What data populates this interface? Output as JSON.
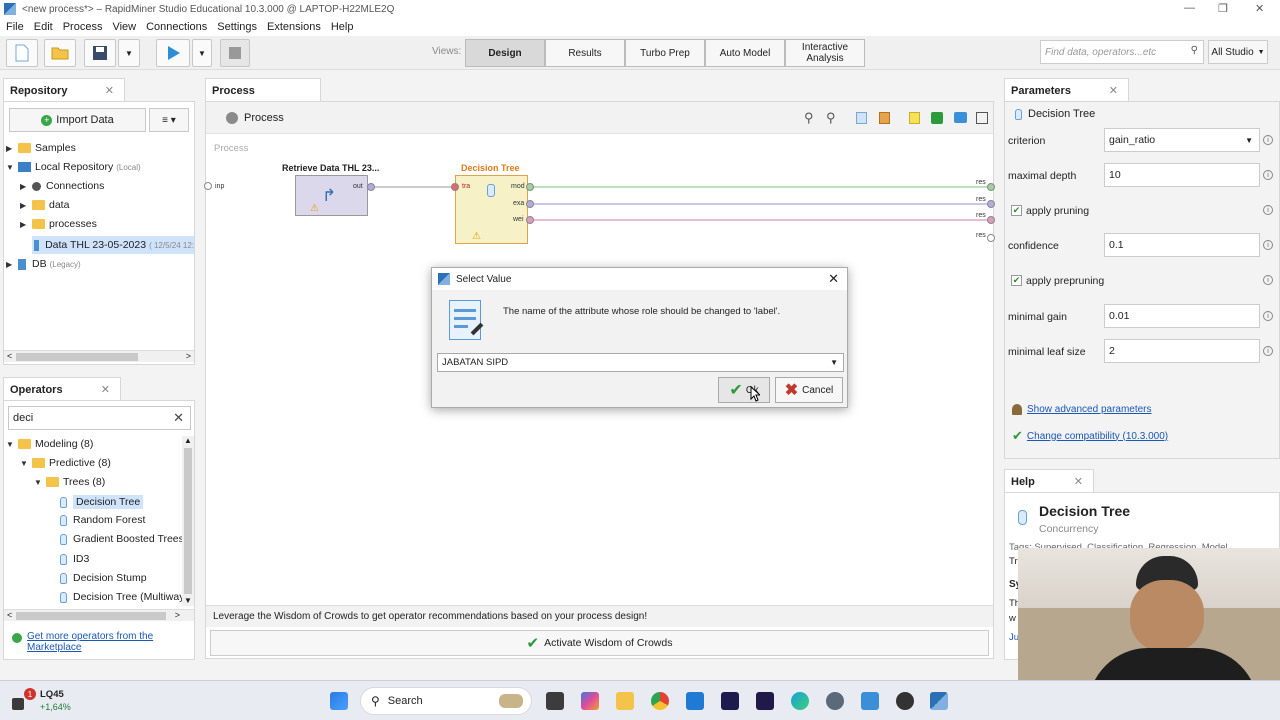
{
  "window": {
    "title": "<new process*> – RapidMiner Studio Educational 10.3.000 @ LAPTOP-H22MLE2Q",
    "controls": [
      "—",
      "❐",
      "✕"
    ]
  },
  "menu": [
    "File",
    "Edit",
    "Process",
    "View",
    "Connections",
    "Settings",
    "Extensions",
    "Help"
  ],
  "toolbar": {
    "views_label": "Views:",
    "views": [
      "Design",
      "Results",
      "Turbo Prep",
      "Auto Model",
      "Interactive Analysis"
    ],
    "active_view": "Design",
    "search_placeholder": "Find data, operators...etc",
    "perspective": "All Studio"
  },
  "repository": {
    "tab": "Repository",
    "import_button": "Import Data",
    "items": [
      {
        "label": "Samples",
        "sub": ""
      },
      {
        "label": "Local Repository",
        "sub": "(Local)"
      },
      {
        "label": "Connections",
        "sub": ""
      },
      {
        "label": "data",
        "sub": ""
      },
      {
        "label": "processes",
        "sub": ""
      },
      {
        "label": "Data THL 23-05-2023",
        "sub": "( 12/5/24 12:"
      },
      {
        "label": "DB",
        "sub": "(Legacy)"
      }
    ]
  },
  "operators": {
    "tab": "Operators",
    "search_value": "deci",
    "items": [
      {
        "label": "Modeling (8)"
      },
      {
        "label": "Predictive (8)"
      },
      {
        "label": "Trees (8)"
      },
      {
        "label": "Decision Tree"
      },
      {
        "label": "Random Forest"
      },
      {
        "label": "Gradient Boosted Trees"
      },
      {
        "label": "ID3"
      },
      {
        "label": "Decision Stump"
      },
      {
        "label": "Decision Tree (Multiway)"
      }
    ],
    "marketplace_link": "Get more operators from the Marketplace"
  },
  "process": {
    "tab": "Process",
    "breadcrumb": "Process",
    "canvas_label": "Process",
    "operator1": {
      "name": "Retrieve Data THL 23...",
      "port_out": "out"
    },
    "operator2": {
      "name": "Decision Tree",
      "ports_in": [
        "tra"
      ],
      "ports_out": [
        "mod",
        "exa",
        "wei"
      ]
    },
    "inp_label": "inp",
    "res_labels": [
      "res",
      "res",
      "res",
      "res"
    ],
    "wisdom_text": "Leverage the Wisdom of Crowds to get operator recommendations based on your process design!",
    "wisdom_button": "Activate Wisdom of Crowds"
  },
  "dialog": {
    "title": "Select Value",
    "message": "The name of the attribute whose role should be changed to 'label'.",
    "selected": "JABATAN SIPD",
    "ok": "Ok",
    "cancel": "Cancel"
  },
  "parameters": {
    "tab": "Parameters",
    "operator": "Decision Tree",
    "rows": [
      {
        "label": "criterion",
        "value": "gain_ratio"
      },
      {
        "label": "maximal depth",
        "value": "10"
      },
      {
        "label": "apply pruning",
        "value": ""
      },
      {
        "label": "confidence",
        "value": "0.1"
      },
      {
        "label": "apply prepruning",
        "value": ""
      },
      {
        "label": "minimal gain",
        "value": "0.01"
      },
      {
        "label": "minimal leaf size",
        "value": "2"
      }
    ],
    "advanced_link": "Show advanced parameters",
    "compat_link": "Change compatibility (10.3.000)"
  },
  "help": {
    "tab": "Help",
    "title": "Decision Tree",
    "subtitle": "Concurrency",
    "tags": "Tags: Supervised, Classification, Regression, Model,",
    "partial1": "Tr",
    "partial2": "Sy",
    "partial3": "Th",
    "partial4": "w",
    "partial5": "Ju"
  },
  "taskbar": {
    "ticker": "LQ45",
    "ticker_change": "+1,64%",
    "search": "Search",
    "badge": "1"
  },
  "colors": {
    "accent": "#2b6fb5",
    "green": "#2a9a3a",
    "orange": "#e07b1a"
  }
}
